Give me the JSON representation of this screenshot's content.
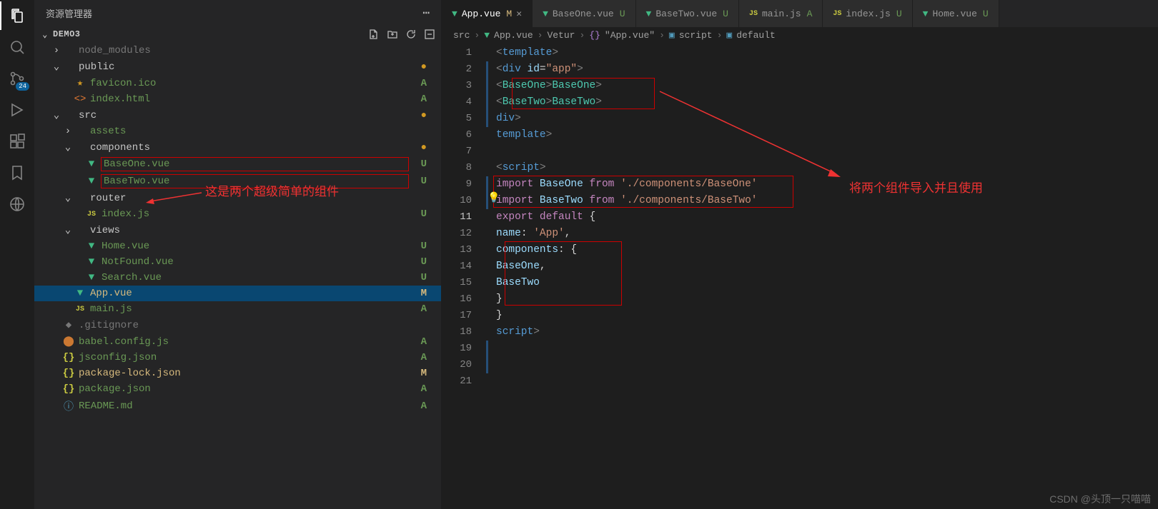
{
  "activityBar": {
    "badge": "24"
  },
  "sidebar": {
    "title": "资源管理器",
    "project": "DEMO3",
    "tree": [
      {
        "depth": 1,
        "chev": ">",
        "icon": "folder",
        "name": "node_modules",
        "color": "c-dim",
        "git": ""
      },
      {
        "depth": 1,
        "chev": "v",
        "icon": "folder",
        "name": "public",
        "color": "c-folder",
        "git": "●",
        "gitc": "dot"
      },
      {
        "depth": 2,
        "chev": "",
        "icon": "star",
        "name": "favicon.ico",
        "color": "c-gold",
        "git": "A",
        "gitc": "git-a",
        "greenText": true
      },
      {
        "depth": 2,
        "chev": "",
        "icon": "html",
        "name": "index.html",
        "color": "c-red",
        "git": "A",
        "gitc": "git-a",
        "greenText": true
      },
      {
        "depth": 1,
        "chev": "v",
        "icon": "folder",
        "name": "src",
        "color": "c-folder",
        "git": "●",
        "gitc": "dot"
      },
      {
        "depth": 2,
        "chev": ">",
        "icon": "folder",
        "name": "assets",
        "color": "c-green",
        "git": "",
        "greenText": true
      },
      {
        "depth": 2,
        "chev": "v",
        "icon": "folder",
        "name": "components",
        "color": "c-folder",
        "git": "●",
        "gitc": "dot"
      },
      {
        "depth": 3,
        "chev": "",
        "icon": "vue",
        "name": "BaseOne.vue",
        "color": "vue-ico",
        "git": "U",
        "gitc": "git-u",
        "greenText": true,
        "redbox": true
      },
      {
        "depth": 3,
        "chev": "",
        "icon": "vue",
        "name": "BaseTwo.vue",
        "color": "vue-ico",
        "git": "U",
        "gitc": "git-u",
        "greenText": true,
        "redbox": true
      },
      {
        "depth": 2,
        "chev": "v",
        "icon": "folder",
        "name": "router",
        "color": "c-folder",
        "git": "",
        "greenText": false
      },
      {
        "depth": 3,
        "chev": "",
        "icon": "js",
        "name": "index.js",
        "color": "js-ico",
        "git": "U",
        "gitc": "git-u",
        "greenText": true
      },
      {
        "depth": 2,
        "chev": "v",
        "icon": "folder",
        "name": "views",
        "color": "c-folder",
        "git": "",
        "greenText": false
      },
      {
        "depth": 3,
        "chev": "",
        "icon": "vue",
        "name": "Home.vue",
        "color": "vue-ico",
        "git": "U",
        "gitc": "git-u",
        "greenText": true
      },
      {
        "depth": 3,
        "chev": "",
        "icon": "vue",
        "name": "NotFound.vue",
        "color": "vue-ico",
        "git": "U",
        "gitc": "git-u",
        "greenText": true
      },
      {
        "depth": 3,
        "chev": "",
        "icon": "vue",
        "name": "Search.vue",
        "color": "vue-ico",
        "git": "U",
        "gitc": "git-u",
        "greenText": true
      },
      {
        "depth": 2,
        "chev": "",
        "icon": "vue",
        "name": "App.vue",
        "color": "vue-ico",
        "git": "M",
        "gitc": "git-m",
        "goldText": true,
        "selected": true
      },
      {
        "depth": 2,
        "chev": "",
        "icon": "js",
        "name": "main.js",
        "color": "js-ico",
        "git": "A",
        "gitc": "git-a",
        "greenText": true
      },
      {
        "depth": 1,
        "chev": "",
        "icon": "git",
        "name": ".gitignore",
        "color": "c-dim",
        "git": ""
      },
      {
        "depth": 1,
        "chev": "",
        "icon": "babel",
        "name": "babel.config.js",
        "color": "c-orange",
        "git": "A",
        "gitc": "git-a",
        "greenText": true
      },
      {
        "depth": 1,
        "chev": "",
        "icon": "json",
        "name": "jsconfig.json",
        "color": "json-brace",
        "git": "A",
        "gitc": "git-a",
        "greenText": true
      },
      {
        "depth": 1,
        "chev": "",
        "icon": "json",
        "name": "package-lock.json",
        "color": "json-brace",
        "git": "M",
        "gitc": "git-m",
        "goldText": true
      },
      {
        "depth": 1,
        "chev": "",
        "icon": "json",
        "name": "package.json",
        "color": "json-brace",
        "git": "A",
        "gitc": "git-a",
        "greenText": true
      },
      {
        "depth": 1,
        "chev": "",
        "icon": "readme",
        "name": "README.md",
        "color": "c-cyan",
        "git": "A",
        "gitc": "git-a",
        "greenText": true
      }
    ],
    "annotation1": "这是两个超级简单的组件"
  },
  "tabs": [
    {
      "icon": "vue",
      "name": "App.vue",
      "status": "M",
      "statusc": "git-m",
      "active": true,
      "close": true
    },
    {
      "icon": "vue",
      "name": "BaseOne.vue",
      "status": "U",
      "statusc": "git-u"
    },
    {
      "icon": "vue",
      "name": "BaseTwo.vue",
      "status": "U",
      "statusc": "git-u"
    },
    {
      "icon": "js",
      "name": "main.js",
      "status": "A",
      "statusc": "git-a"
    },
    {
      "icon": "js",
      "name": "index.js",
      "status": "U",
      "statusc": "git-u"
    },
    {
      "icon": "vue",
      "name": "Home.vue",
      "status": "U",
      "statusc": "git-u"
    }
  ],
  "breadcrumb": {
    "parts": [
      "src",
      "App.vue",
      "Vetur",
      "\"App.vue\"",
      "script",
      "default"
    ]
  },
  "lineNumbers": [
    "1",
    "2",
    "3",
    "4",
    "5",
    "6",
    "7",
    "8",
    "9",
    "10",
    "11",
    "12",
    "13",
    "14",
    "15",
    "16",
    "17",
    "18",
    "19",
    "20",
    "21"
  ],
  "currentLine": 11,
  "code": {
    "l1": {
      "a": "<",
      "b": "template",
      "c": ">"
    },
    "l2": {
      "a": "<",
      "b": "div",
      "sp": " ",
      "attr": "id",
      "eq": "=",
      "q": "\"app\"",
      "c": ">"
    },
    "l3": {
      "a": "<",
      "b": "BaseOne",
      "c": "></",
      "d": "BaseOne",
      "e": ">"
    },
    "l4": {
      "a": "<",
      "b": "BaseTwo",
      "c": "></",
      "d": "BaseTwo",
      "e": ">"
    },
    "l5": {
      "a": "</",
      "b": "div",
      "c": ">"
    },
    "l6": {
      "a": "</",
      "b": "template",
      "c": ">"
    },
    "l8": {
      "a": "<",
      "b": "script",
      "c": ">"
    },
    "l9": {
      "kw": "import",
      "sp": " ",
      "id": "BaseOne",
      "sp2": " ",
      "kw2": "from",
      "sp3": " ",
      "str": "'./components/BaseOne'"
    },
    "l10": {
      "kw": "import",
      "sp": " ",
      "id": "BaseTwo",
      "sp2": " ",
      "kw2": "from",
      "sp3": " ",
      "str": "'./components/BaseTwo'"
    },
    "l11": {
      "kw": "export",
      "sp": " ",
      "kw2": "default",
      "sp2": " ",
      "br": "{"
    },
    "l12": {
      "id": "name",
      "col": ":",
      "sp": " ",
      "str": "'App'",
      "com": ","
    },
    "l13": {
      "id": "components",
      "col": ":",
      "sp": " ",
      "br": "{"
    },
    "l14": {
      "id": "BaseOne",
      "com": ","
    },
    "l15": {
      "id": "BaseTwo"
    },
    "l16": {
      "br": "}"
    },
    "l17": {
      "br": "}"
    },
    "l18": {
      "a": "</",
      "b": "script",
      "c": ">"
    }
  },
  "annotation2": "将两个组件导入并且使用",
  "watermark": "CSDN @头顶一只喵喵"
}
